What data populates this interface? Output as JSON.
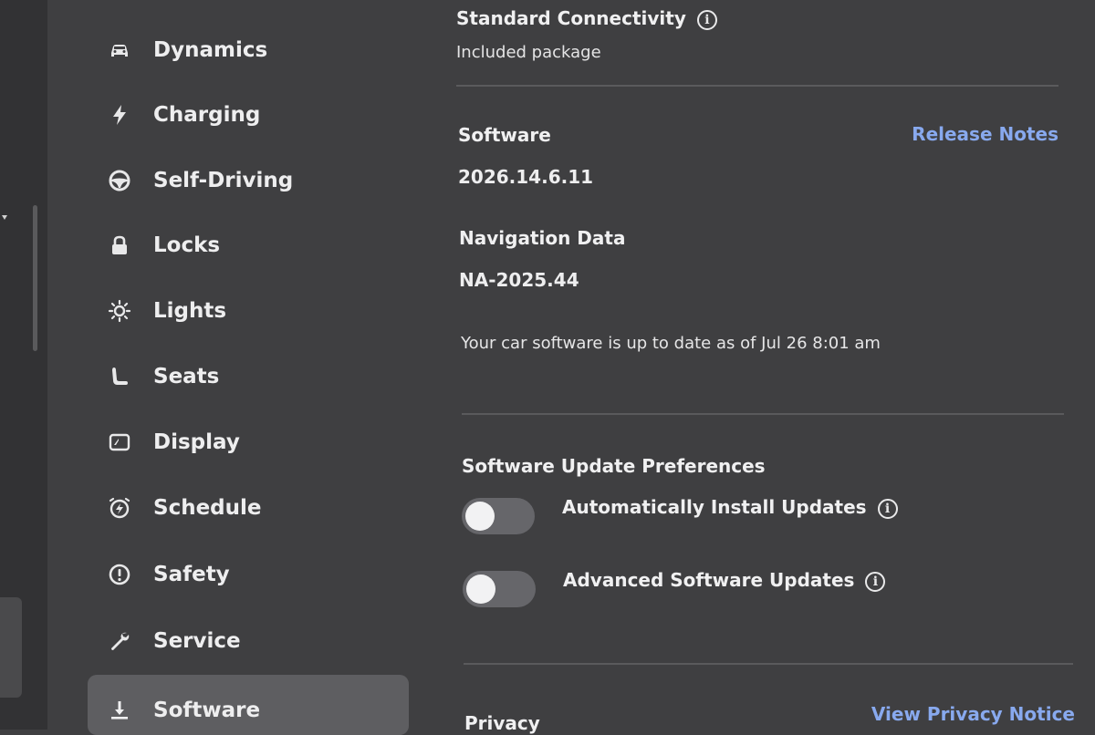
{
  "sidebar": {
    "items": [
      {
        "label": "Dynamics",
        "icon": "car-icon"
      },
      {
        "label": "Charging",
        "icon": "lightning-bolt-icon"
      },
      {
        "label": "Self-Driving",
        "icon": "steering-wheel-icon"
      },
      {
        "label": "Locks",
        "icon": "lock-icon"
      },
      {
        "label": "Lights",
        "icon": "light-bulb-icon"
      },
      {
        "label": "Seats",
        "icon": "seat-icon"
      },
      {
        "label": "Display",
        "icon": "display-icon"
      },
      {
        "label": "Schedule",
        "icon": "alarm-clock-icon"
      },
      {
        "label": "Safety",
        "icon": "alert-circle-icon"
      },
      {
        "label": "Service",
        "icon": "wrench-icon"
      },
      {
        "label": "Software",
        "icon": "download-icon",
        "active": true
      }
    ]
  },
  "connectivity": {
    "title": "Standard Connectivity",
    "subtitle": "Included package"
  },
  "software": {
    "title": "Software",
    "release_notes_link": "Release Notes",
    "version": "2026.14.6.11",
    "nav_data_title": "Navigation Data",
    "nav_data_version": "NA-2025.44",
    "status": "Your car software is up to date as of Jul 26 8:01 am"
  },
  "update_preferences": {
    "title": "Software Update Preferences",
    "toggles": [
      {
        "label": "Automatically Install Updates",
        "on": false
      },
      {
        "label": "Advanced Software Updates",
        "on": false
      }
    ]
  },
  "privacy": {
    "title": "Privacy",
    "link": "View Privacy Notice"
  },
  "colors": {
    "background": "#3f3f41",
    "sidebar_active": "#5e5e61",
    "link": "#88a9ee",
    "toggle_off_track": "#66666a"
  }
}
